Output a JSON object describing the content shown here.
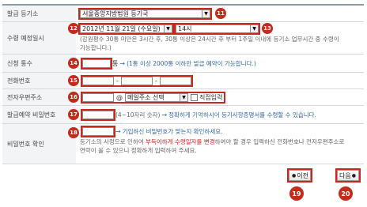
{
  "rows": {
    "court": {
      "label": "발급 등기소",
      "value": "서울중앙지방법원 등기국"
    },
    "schedule": {
      "label": "수령 예정일시",
      "date": "2012년 11월 21일 (수요일)",
      "time": "14시",
      "note": "(강원평수 30통 미만은 3시간 후, 30통 이상은 24시간 후 부터 1주일 이내에 등기소 업무시간 중 수령이 가능합니다.)"
    },
    "count": {
      "label": "신청 통수",
      "unit": "통",
      "note": "(1통 이상 2000통 이하만 발급 예약이 가능합니다.)"
    },
    "phone": {
      "label": "전화번호",
      "sep1": "-",
      "sep2": "-"
    },
    "email": {
      "label": "전자우편주소",
      "at": "@",
      "domain_select": "메일주소 선택",
      "direct_label": "직접입력"
    },
    "password": {
      "label": "발급예약 비밀번호",
      "hint": "(4~10자리 숫자)",
      "note": "정확하게 기억하시어 등기사항증명서를 수령할 수 있습니다."
    },
    "confirm": {
      "label": "비밀번호 확인",
      "note": "기입하신 비밀번호가 맞는지 확인하세요.",
      "desc_a": "등기소의 사정으로 인하여 ",
      "desc_red": "부득이하게 수령일자를 변경",
      "desc_b": "하여야 할 경우 입력하신 전화번호나 전자우편주소로 연락이 올 수 있으니 정확하게 입력하여 주세요."
    }
  },
  "buttons": {
    "prev": "이전",
    "next": "다음"
  },
  "badges": [
    "11",
    "12",
    "13",
    "14",
    "15",
    "16",
    "17",
    "18",
    "19",
    "20"
  ],
  "colors": {
    "badge": "#c32b1d",
    "highlight": "#c9281f",
    "link": "#3366aa"
  }
}
